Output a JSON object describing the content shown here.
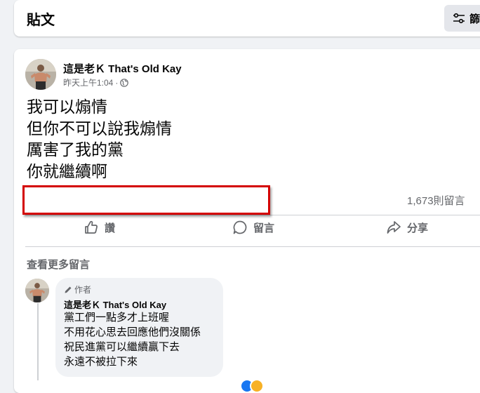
{
  "header": {
    "title": "貼文",
    "filter_label": "篩選"
  },
  "post": {
    "author": "這是老Ｋ That's Old Kay",
    "time": "昨天上午1:04",
    "separator": "·",
    "audience_icon": "globe-icon",
    "body_lines": [
      "我可以煽情",
      "但你不可以說我煽情",
      "厲害了我的黨",
      "你就繼續啊"
    ],
    "comment_count": "1,673則留言",
    "actions": {
      "like": "讚",
      "comment": "留言",
      "share": "分享"
    }
  },
  "comments": {
    "view_more": "查看更多留言",
    "items": [
      {
        "badge": "作者",
        "author": "這是老Ｋ That's Old Kay",
        "lines": [
          "黨工們一點多才上班喔",
          "不用花心思去回應他們沒關係",
          "祝民進黨可以繼續贏下去",
          "永遠不被拉下來"
        ]
      }
    ]
  },
  "colors": {
    "highlight_border": "#d40000",
    "secondary_text": "#65676b",
    "page_background": "#f0f2f5"
  }
}
